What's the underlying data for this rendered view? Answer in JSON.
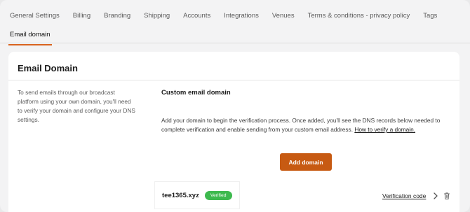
{
  "top_tabs": [
    "General Settings",
    "Billing",
    "Branding",
    "Shipping",
    "Accounts",
    "Integrations",
    "Venues",
    "Terms & conditions - privacy policy",
    "Tags"
  ],
  "sub_tab": "Email domain",
  "panel": {
    "title": "Email Domain",
    "description": "To send emails through our broadcast platform using your own domain, you'll need to verify your domain and configure your DNS settings.",
    "custom_title": "Custom email domain",
    "custom_text": "Add your domain to begin the verification process. Once added, you'll see the DNS records below needed to complete verification and enable sending from your custom email address.",
    "custom_link": "How to verify a domain.",
    "add_button": "Add domain"
  },
  "domain": {
    "name": "tee1365.xyz",
    "status": "Verified",
    "verification_link": "Verification code"
  },
  "icons": {
    "chevron": "chevron-right-icon",
    "delete": "trash-icon"
  },
  "colors": {
    "accent": "#c75a12",
    "tab_underline": "#d9641f",
    "verified": "#3db94e"
  }
}
